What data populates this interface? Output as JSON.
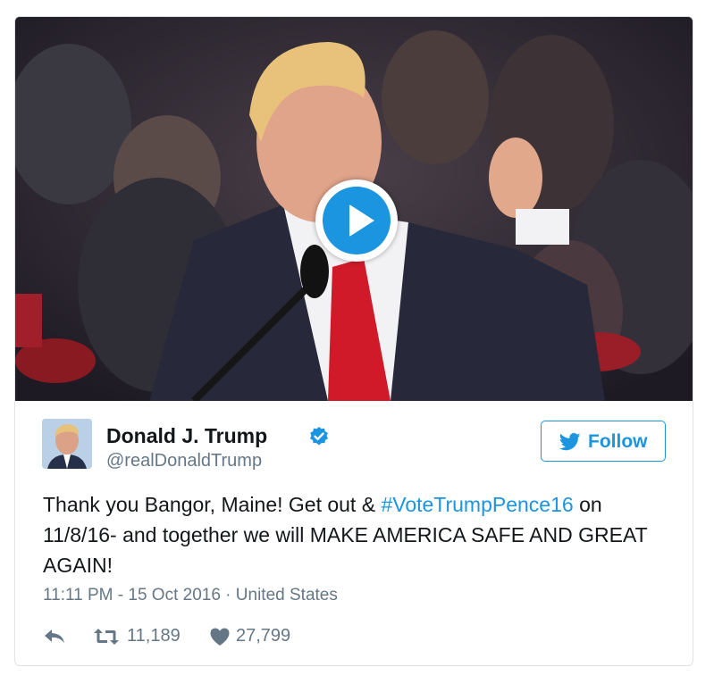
{
  "tweet": {
    "author": {
      "name": "Donald J. Trump",
      "handle": "@realDonaldTrump",
      "verified_icon": "verified-badge-icon"
    },
    "follow_label": "Follow",
    "text_parts": {
      "before": "Thank you Bangor, Maine! Get out & ",
      "hashtag": "#VoteTrumpPence16",
      "after": " on 11/8/16- and together we will MAKE AMERICA SAFE AND GREAT AGAIN!"
    },
    "timestamp": "11:11 PM - 15 Oct 2016",
    "separator": " · ",
    "location": "United States",
    "retweets": "11,189",
    "likes": "27,799"
  },
  "colors": {
    "accent": "#1b95e0",
    "secondary_text": "#657786",
    "primary_text": "#14171a"
  }
}
